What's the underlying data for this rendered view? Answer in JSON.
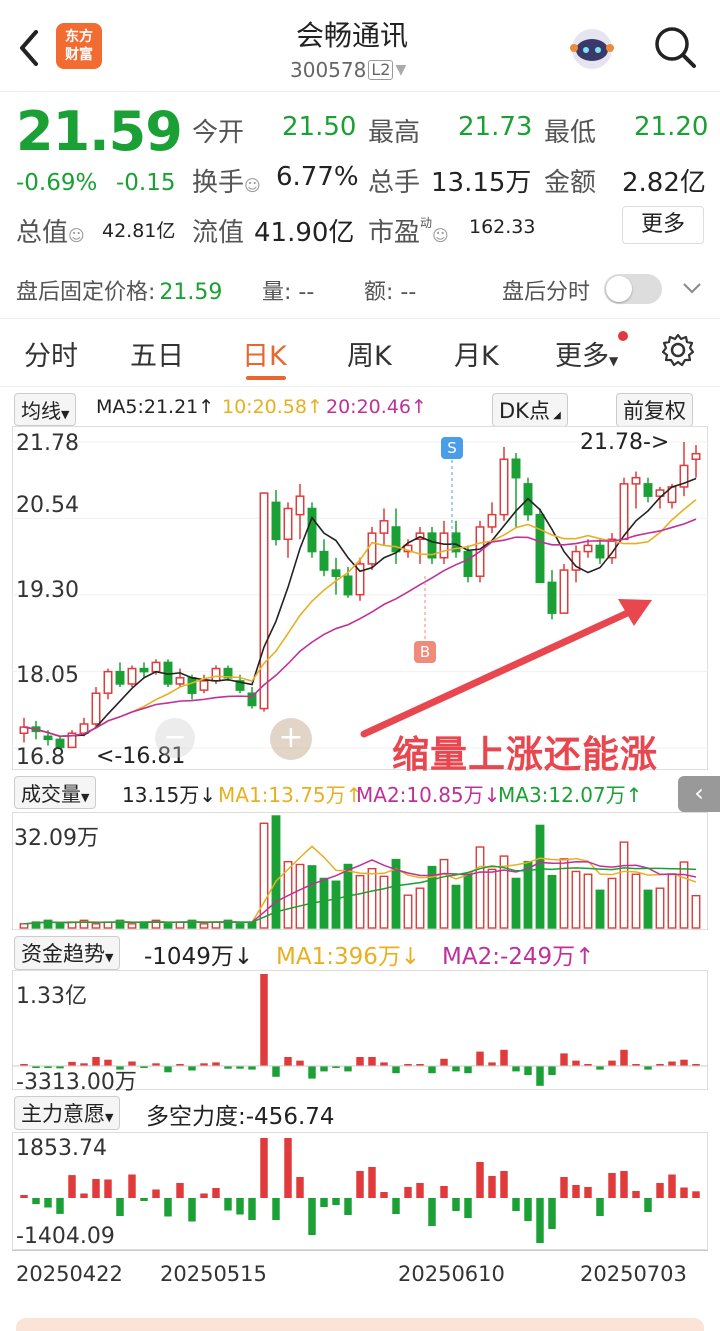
{
  "header": {
    "title": "会畅通讯",
    "code": "300578",
    "level": "L2",
    "logo_line1": "东方",
    "logo_line2": "财富"
  },
  "quote": {
    "price": "21.59",
    "change_pct": "-0.69%",
    "change": "-0.15",
    "open_label": "今开",
    "open": "21.50",
    "high_label": "最高",
    "high": "21.73",
    "low_label": "最低",
    "low": "21.20",
    "turnover_label": "换手",
    "turnover": "6.77%",
    "volume_label": "总手",
    "volume": "13.15万",
    "amount_label": "金额",
    "amount": "2.82亿",
    "mktcap_label": "总值",
    "mktcap": "42.81亿",
    "float_label": "流值",
    "float": "41.90亿",
    "pe_label": "市盈",
    "pe_sup": "动",
    "pe": "162.33",
    "more": "更多"
  },
  "afterhours": {
    "price_label": "盘后固定价格:",
    "price": "21.59",
    "vol_label": "量:",
    "vol": "--",
    "amt_label": "额:",
    "amt": "--",
    "toggle_label": "盘后分时"
  },
  "tabs": [
    "分时",
    "五日",
    "日K",
    "周K",
    "月K",
    "更多"
  ],
  "kline": {
    "ma_select": "均线",
    "ma5": "MA5:21.21↑",
    "ma10": "10:20.58↑",
    "ma20": "20:20.46↑",
    "dk": "DK点",
    "adjust": "前复权",
    "y_ticks": [
      "21.78",
      "20.54",
      "19.30",
      "18.05",
      "16.81"
    ],
    "max_label": "21.78->",
    "min_label": "<-16.81",
    "min_prefix": "16.8",
    "marker_s": "S",
    "marker_b": "B",
    "annotation": "缩量上涨还能涨",
    "colors": {
      "up": "#e03a3a",
      "down": "#1aa034",
      "ma5": "#222222",
      "ma10": "#e8b020",
      "ma20": "#c0309a",
      "arrow": "#e8474f"
    }
  },
  "volume": {
    "select": "成交量",
    "value": "13.15万↓",
    "ma1": "MA1:13.75万↑",
    "ma2": "MA2:10.85万↓",
    "ma3": "MA3:12.07万↑",
    "top": "32.09万"
  },
  "capital": {
    "select": "资金趋势",
    "value": "-1049万↓",
    "ma1": "MA1:396万↓",
    "ma2": "MA2:-249万↑",
    "top": "1.33亿",
    "bottom": "-3313.00万"
  },
  "main_force": {
    "select": "主力意愿",
    "label": "多空力度:-456.74",
    "top": "1853.74",
    "bottom": "-1404.09"
  },
  "dates": [
    "20250422",
    "20250515",
    "20250610",
    "20250703"
  ],
  "chart_data": {
    "type": "candlestick",
    "ylim": [
      16.81,
      21.78
    ],
    "candles": [
      [
        17.05,
        17.15,
        17.3,
        16.9
      ],
      [
        17.15,
        17.08,
        17.25,
        16.95
      ],
      [
        17.0,
        16.95,
        17.1,
        16.85
      ],
      [
        16.95,
        16.82,
        17.0,
        16.81
      ],
      [
        16.82,
        17.05,
        17.1,
        16.81
      ],
      [
        17.05,
        17.2,
        17.3,
        17.0
      ],
      [
        17.2,
        17.7,
        17.8,
        17.15
      ],
      [
        17.7,
        18.05,
        18.1,
        17.6
      ],
      [
        18.05,
        17.85,
        18.2,
        17.8
      ],
      [
        17.85,
        18.1,
        18.15,
        17.8
      ],
      [
        18.1,
        18.05,
        18.2,
        17.95
      ],
      [
        18.05,
        18.2,
        18.25,
        18.0
      ],
      [
        18.2,
        17.85,
        18.25,
        17.8
      ],
      [
        17.85,
        17.95,
        18.1,
        17.8
      ],
      [
        17.95,
        17.7,
        18.0,
        17.6
      ],
      [
        17.75,
        17.9,
        18.0,
        17.7
      ],
      [
        17.9,
        18.1,
        18.15,
        17.85
      ],
      [
        18.1,
        17.95,
        18.15,
        17.9
      ],
      [
        17.9,
        17.75,
        18.0,
        17.7
      ],
      [
        17.7,
        17.5,
        17.8,
        17.45
      ],
      [
        17.45,
        20.95,
        20.95,
        17.4
      ],
      [
        20.8,
        20.2,
        21.0,
        20.1
      ],
      [
        20.2,
        20.7,
        20.8,
        19.9
      ],
      [
        20.6,
        20.9,
        21.1,
        20.2
      ],
      [
        20.7,
        20.0,
        20.8,
        19.9
      ],
      [
        20.0,
        19.7,
        20.2,
        19.6
      ],
      [
        19.7,
        19.6,
        19.9,
        19.3
      ],
      [
        19.6,
        19.3,
        19.75,
        19.25
      ],
      [
        19.3,
        19.8,
        19.9,
        19.2
      ],
      [
        19.8,
        20.3,
        20.4,
        19.7
      ],
      [
        20.3,
        20.5,
        20.7,
        20.1
      ],
      [
        20.4,
        20.0,
        20.7,
        19.8
      ],
      [
        20.0,
        20.1,
        20.2,
        19.9
      ],
      [
        20.2,
        20.3,
        20.4,
        19.8
      ],
      [
        20.3,
        19.9,
        20.4,
        19.8
      ],
      [
        19.9,
        20.3,
        20.5,
        19.8
      ],
      [
        20.3,
        20.0,
        20.5,
        19.9
      ],
      [
        20.0,
        19.6,
        20.1,
        19.5
      ],
      [
        19.6,
        20.4,
        20.5,
        19.5
      ],
      [
        20.4,
        20.6,
        20.8,
        20.3
      ],
      [
        20.6,
        21.5,
        21.7,
        20.5
      ],
      [
        21.5,
        21.2,
        21.6,
        20.4
      ],
      [
        21.1,
        20.6,
        21.2,
        20.5
      ],
      [
        20.6,
        19.5,
        20.7,
        19.5
      ],
      [
        19.5,
        19.0,
        19.7,
        18.9
      ],
      [
        19.0,
        19.7,
        19.8,
        19.0
      ],
      [
        19.7,
        20.0,
        20.1,
        19.5
      ],
      [
        20.0,
        20.1,
        20.2,
        19.9
      ],
      [
        20.1,
        19.9,
        20.2,
        19.8
      ],
      [
        19.9,
        20.2,
        20.3,
        19.8
      ],
      [
        20.2,
        21.1,
        21.2,
        20.2
      ],
      [
        21.1,
        21.2,
        21.3,
        20.7
      ],
      [
        21.1,
        20.9,
        21.2,
        20.8
      ],
      [
        20.9,
        21.0,
        21.05,
        20.7
      ],
      [
        20.8,
        21.05,
        21.1,
        20.7
      ],
      [
        21.05,
        21.4,
        21.78,
        20.9
      ],
      [
        21.5,
        21.59,
        21.73,
        21.2
      ]
    ],
    "volume_max": 32.09
  }
}
